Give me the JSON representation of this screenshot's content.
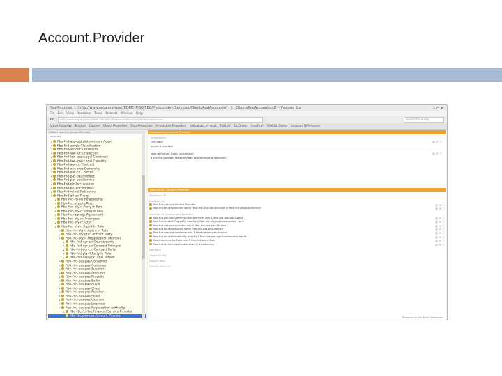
{
  "slide": {
    "title": "Account.Provider"
  },
  "colors": {
    "accent_orange": "#d9824e",
    "accent_blue": "#a7bcd2",
    "section_header": "#e9a431"
  },
  "app": {
    "title": "fibo-finances ... (http://www.omg.org/spec/EDMC-FIBO/FBC/ProductsAndServices/ClientsAndAccounts/) : [...ClientsAndAccounts.rdf] - Protege 5.x",
    "menu": [
      "File",
      "Edit",
      "View",
      "Reasoner",
      "Tools",
      "Refactor",
      "Window",
      "Help"
    ],
    "url": "http://www.omg.org/spec/EDMC-FIBO/FBC/ProductsAndServices/ClientsAndAccounts/",
    "search_placeholder": "Search for entity",
    "tabs": [
      "Active Ontology",
      "Entities",
      "Classes",
      "Object Properties",
      "Data Properties",
      "Annotation Properties",
      "Individuals by class",
      "OWLViz",
      "DL Query",
      "OntoGraf",
      "SPARQL Query",
      "Ontology Differences"
    ]
  },
  "left_panel": {
    "title": "Class hierarchy: AccountProvider",
    "search_label": "Asserted",
    "tree": [
      {
        "label": "fibo-fnd-aap-agt:Autonomous Agent",
        "level": 0,
        "selected": false
      },
      {
        "label": "fibo-fnd-arr-cls:Classification",
        "level": 0,
        "selected": false
      },
      {
        "label": "fibo-fnd-arr-doc:Document",
        "level": 0,
        "selected": false
      },
      {
        "label": "fibo-fnd-law-jur:Jurisdiction",
        "level": 0,
        "selected": false
      },
      {
        "label": "fibo-fnd-law-lcap:Legal Construct",
        "level": 0,
        "selected": false
      },
      {
        "label": "fibo-fnd-law-lcap:Legal Capacity",
        "level": 0,
        "selected": false
      },
      {
        "label": "fibo-fnd-agr-ctr:Contract",
        "level": 0,
        "selected": false
      },
      {
        "label": "fibo-fnd-oac-own:Ownership",
        "level": 0,
        "selected": false
      },
      {
        "label": "fibo-fnd-oac-ctl:Control",
        "level": 0,
        "selected": false
      },
      {
        "label": "fibo-fnd-pas-pas:Product",
        "level": 0,
        "selected": false
      },
      {
        "label": "fibo-fnd-pas-pas:Service",
        "level": 0,
        "selected": false
      },
      {
        "label": "fibo-fnd-plc-loc:Location",
        "level": 0,
        "selected": false
      },
      {
        "label": "fibo-fnd-plc-adr:Address",
        "level": 0,
        "selected": false
      },
      {
        "label": "fibo-fnd-rel-rel:Reference",
        "level": 0,
        "selected": false
      },
      {
        "label": "fibo-fnd-utl-av:Thing",
        "level": 0,
        "selected": false
      },
      {
        "label": "fibo-fnd-rel-rel:Relationship",
        "level": 1,
        "selected": false
      },
      {
        "label": "fibo-fnd-pty-pty:Party",
        "level": 1,
        "selected": false
      },
      {
        "label": "fibo-fnd-pty-rl:Party In Role",
        "level": 1,
        "selected": false
      },
      {
        "label": "fibo-fnd-pty-rl:Thing In Role",
        "level": 1,
        "selected": false
      },
      {
        "label": "fibo-fnd-agr-agr:Agreement",
        "level": 1,
        "selected": false
      },
      {
        "label": "fibo-fnd-pty-rl:Undergoer",
        "level": 1,
        "selected": false
      },
      {
        "label": "fibo-fnd-pty-rl:Actor",
        "level": 1,
        "selected": false
      },
      {
        "label": "fibo-fnd-pty-rl:Agent In Role",
        "level": 1,
        "selected": false
      },
      {
        "label": "fibo-fnd-pty-rl:Agent In Role",
        "level": 2,
        "selected": false
      },
      {
        "label": "fibo-fnd-pty-pty:Contract Party",
        "level": 2,
        "selected": false
      },
      {
        "label": "fibo-fnd-pty-rl:Organization Member",
        "level": 2,
        "selected": false
      },
      {
        "label": "fibo-fnd-agr-ctr:Counterparty",
        "level": 3,
        "selected": false
      },
      {
        "label": "fibo-fnd-agr-ctr:Contract Principal",
        "level": 3,
        "selected": false
      },
      {
        "label": "fibo-fnd-agr-ctr:Contract Party",
        "level": 3,
        "selected": false
      },
      {
        "label": "fibo-fnd-pty-rl:Party In Role",
        "level": 3,
        "selected": false
      },
      {
        "label": "fibo-fnd-aap-ppl:Legal Person",
        "level": 3,
        "selected": false
      },
      {
        "label": "fibo-fnd-pas-pas:Consumer",
        "level": 2,
        "selected": false
      },
      {
        "label": "fibo-fnd-pas-pas:Customer",
        "level": 2,
        "selected": false
      },
      {
        "label": "fibo-fnd-pas-pas:Supplier",
        "level": 2,
        "selected": false
      },
      {
        "label": "fibo-fnd-pas-pas:Producer",
        "level": 2,
        "selected": false
      },
      {
        "label": "fibo-fnd-pas-pas:Provider",
        "level": 2,
        "selected": false
      },
      {
        "label": "fibo-fnd-pas-pas:Seller",
        "level": 2,
        "selected": false
      },
      {
        "label": "fibo-fnd-pas-pas:Buyer",
        "level": 2,
        "selected": false
      },
      {
        "label": "fibo-fnd-pas-pas:Client",
        "level": 2,
        "selected": false
      },
      {
        "label": "fibo-fnd-pas-pas:Reseller",
        "level": 2,
        "selected": false
      },
      {
        "label": "fibo-fnd-pas-pas:Seller",
        "level": 2,
        "selected": false
      },
      {
        "label": "fibo-fnd-pas-pas:Licensor",
        "level": 2,
        "selected": false
      },
      {
        "label": "fibo-fnd-pas-pas:Licensee",
        "level": 2,
        "selected": false
      },
      {
        "label": "fibo-fnd-pas-pas:Registration Authority",
        "level": 2,
        "selected": false
      },
      {
        "label": "fibo-fbc-fct-fse:Financial Service Provider",
        "level": 3,
        "selected": false
      },
      {
        "label": "fibo-fbc-pas-caa:Account Provider",
        "level": 3,
        "selected": true
      }
    ]
  },
  "right_panel": {
    "annotations_header": "Annotations: Account Provider",
    "annotations_label": "Annotations",
    "label_field": "rdfs:label",
    "label_value": "account provider",
    "definition_field": "skos:definition [type: xsd:string]",
    "definition_value": "a service provider that provides and services an account",
    "description_header": "Description: Account Provider",
    "equivalent_label": "Equivalent To",
    "subclass_label": "SubClass Of",
    "subclass_of": [
      "fibo-fnd-pas-pas:Service Provider",
      "fibo-fnd-rel-rel:provides some (fibo-fbc-pas-caa:Account or fibo-fnd-pas-pas:Service)"
    ],
    "inherited_label": "SubClass Of (Anonymous Ancestor)",
    "inherited": [
      "fibo-fnd-pty-pty:hasPartyInRoleIdentifier min 1 fibo-fnd-aap-agt:Agent",
      "fibo-fnd-rel-rel:isPlayedBy exactly 1 fibo-fnd-pty-pty:Independent Party",
      "fibo-fnd-pas-pas:provides min 1 fibo-fnd-pas-pas:Service",
      "fibo-fnd-rel-rel:provides some fibo-fnd-pas-pas:Service",
      "fibo-fnd-aap-agt:hasName min 1 fibo-fnd-pas-pas:Service",
      "fibo-fnd-rel-rel:hasIdentity exactly 1 fibo-fnd-aap-agt:Autonomous Agent",
      "fibo-fnd-utl-av:hasRole min 0 fibo-fnd-pty-rl:Role",
      "fibo-fnd-rel-rel:isApplicable exactly 1 xsd:string"
    ],
    "members_label": "Members",
    "target_key_label": "Target for Key",
    "disjoint_label": "Disjoint With",
    "disjoint_union_label": "Disjoint Union Of"
  },
  "status": "Reasoner active  Show Inferences"
}
